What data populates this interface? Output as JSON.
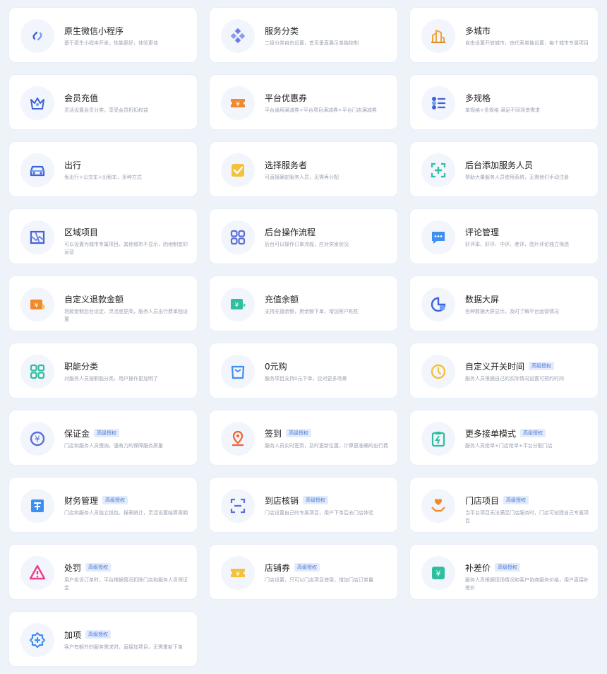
{
  "features": [
    {
      "title": "原生微信小程序",
      "desc": "基于原生小程序开发，性能更好，体验更佳",
      "badge": "",
      "icon": "link-icon"
    },
    {
      "title": "服务分类",
      "desc": "二级分类自由设置，首页垂直展示单独控制",
      "badge": "",
      "icon": "category-icon"
    },
    {
      "title": "多城市",
      "desc": "自由设置开放城市，由代表单独设置，每个城市专属项目",
      "badge": "",
      "icon": "city-icon"
    },
    {
      "title": "会员充值",
      "desc": "灵活设置会员分类，享受会员折扣权益",
      "badge": "",
      "icon": "crown-icon"
    },
    {
      "title": "平台优惠券",
      "desc": "平台通用满减券+平台项目满减券+平台门店满减券",
      "badge": "",
      "icon": "coupon-icon"
    },
    {
      "title": "多规格",
      "desc": "单规格+多规格 满足不同场景需求",
      "badge": "",
      "icon": "spec-list-icon"
    },
    {
      "title": "出行",
      "desc": "免出行+公交车+出租车，多种方式",
      "badge": "",
      "icon": "car-icon"
    },
    {
      "title": "选择服务者",
      "desc": "可直接确定服务人员，无需再分配",
      "badge": "",
      "icon": "check-box-icon"
    },
    {
      "title": "后台添加服务人员",
      "desc": "帮助大量服务人员使用系统，无需他们手动注册",
      "badge": "",
      "icon": "add-staff-icon"
    },
    {
      "title": "区域项目",
      "desc": "可以设置为城市专属项目，其他城市不显示，因地制宜的运营",
      "badge": "",
      "icon": "region-icon"
    },
    {
      "title": "后台操作流程",
      "desc": "后台可以操作订单流程，应对突发状况",
      "badge": "",
      "icon": "grid-apps-icon"
    },
    {
      "title": "评论管理",
      "desc": "好评率、好评、中评、差评、图片评论独立筛选",
      "badge": "",
      "icon": "comment-icon"
    },
    {
      "title": "自定义退款金额",
      "desc": "退款金额后台设定，灵活度更高，服务人员出行费单独设置",
      "badge": "",
      "icon": "refund-icon"
    },
    {
      "title": "充值余额",
      "desc": "支持充值余额，用余额下单，增加客户粘性",
      "badge": "",
      "icon": "recharge-icon"
    },
    {
      "title": "数据大屏",
      "desc": "各种数据大屏显示，及时了解平台运营情况",
      "badge": "",
      "icon": "pie-chart-icon"
    },
    {
      "title": "职能分类",
      "desc": "对服务人员按职能分类，用户操作更加明了",
      "badge": "",
      "icon": "function-grid-icon"
    },
    {
      "title": "0元购",
      "desc": "服务项目支持0元下单，应对更多场景",
      "badge": "",
      "icon": "bag-icon"
    },
    {
      "title": "自定义开关时间",
      "desc": "服务人员根据自己的实际情况设置可预约时间",
      "badge": "高级授权",
      "icon": "clock-icon"
    },
    {
      "title": "保证金",
      "desc": "门店和服务人员缴纳，强有力的保障服务质量",
      "badge": "高级授权",
      "icon": "yuan-circle-icon"
    },
    {
      "title": "签到",
      "desc": "服务人员实时签到，及时更新位置，计算更准确的出行费",
      "badge": "高级授权",
      "icon": "location-pin-icon"
    },
    {
      "title": "更多接单模式",
      "desc": "服务人员抢单+门店抢单+平台分配门店",
      "badge": "高级授权",
      "icon": "clipboard-flash-icon"
    },
    {
      "title": "财务管理",
      "desc": "门店和服务人员独立钱包，报表统计，灵活设置结算周期",
      "badge": "高级授权",
      "icon": "finance-icon"
    },
    {
      "title": "到店核销",
      "desc": "门店设置自己的专属项目，用户下单后去门店体验",
      "badge": "高级授权",
      "icon": "scan-icon"
    },
    {
      "title": "门店项目",
      "desc": "当平台项目无法满足门店服务时，门店可创建自己专属项目",
      "badge": "高级授权",
      "icon": "hand-heart-icon"
    },
    {
      "title": "处罚",
      "desc": "用户投诉订单时，平台根据情况扣除门店和服务人员保证金",
      "badge": "高级授权",
      "icon": "warning-icon"
    },
    {
      "title": "店铺券",
      "desc": "门店设置，只可以门店项目使用，增加门店订单量",
      "badge": "高级授权",
      "icon": "shop-coupon-icon"
    },
    {
      "title": "补差价",
      "desc": "服务人员根据现场情况和客户协商服务价格，用户直接补差价",
      "badge": "高级授权",
      "icon": "price-diff-icon"
    },
    {
      "title": "加项",
      "desc": "客户有额外的服务需求时，直接加项目，无需重新下单",
      "badge": "高级授权",
      "icon": "add-item-icon"
    }
  ],
  "colors": {
    "title": "#222222",
    "desc": "#9aa2b1",
    "badge_bg": "#e4ecfb",
    "badge_text": "#4a78d8",
    "card_bg": "#ffffff",
    "page_bg": "#eef3fa"
  }
}
